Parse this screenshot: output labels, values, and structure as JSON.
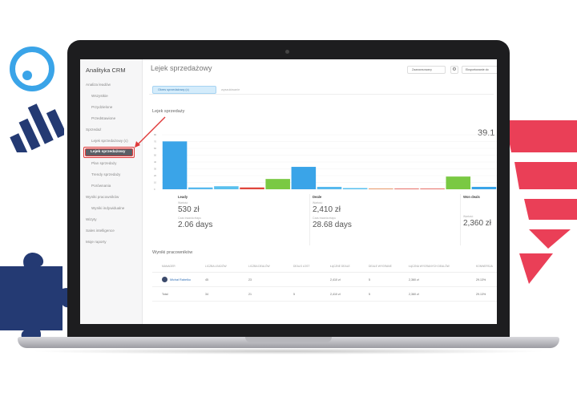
{
  "app": {
    "title": "Analityka CRM"
  },
  "sidebar": {
    "items": [
      {
        "label": "Analiza leadów"
      },
      {
        "label": "Wszystkie"
      },
      {
        "label": "Przydzielone"
      },
      {
        "label": "Przedstawione"
      },
      {
        "label": "Sprzedaż"
      },
      {
        "label": "Lejek sprzedażowy (c)"
      },
      {
        "label": "Lejek sprzedażowy"
      },
      {
        "label": "Plan sprzedaży"
      },
      {
        "label": "Trendy sprzedaży"
      },
      {
        "label": "Porównania"
      },
      {
        "label": "Wyniki pracowników"
      },
      {
        "label": "Wyniki indywidualne"
      },
      {
        "label": "Wizyty"
      },
      {
        "label": "Sales intelligence"
      },
      {
        "label": "Moje raporty"
      }
    ]
  },
  "header": {
    "page_title": "Lejek sprzedażowy",
    "select_label": "Zaawansowany",
    "settings_icon": "gear-icon",
    "button_label": "Eksportowanie do"
  },
  "filters": {
    "chip_label": "Okres sprzedażowy (c)",
    "search_placeholder": "wyszukiwanie"
  },
  "funnel_section": {
    "title": "Lejek sprzedaży",
    "top_right_partial": "39.1"
  },
  "chart_data": {
    "type": "bar",
    "categories": [
      "",
      "",
      "",
      "",
      "",
      "",
      "",
      "",
      "",
      "",
      "",
      "",
      ""
    ],
    "values": [
      79,
      3,
      5,
      3,
      17,
      37,
      4,
      2,
      1,
      1,
      1,
      21,
      4
    ],
    "colors": [
      "#3aa4e8",
      "#57b9ee",
      "#5ac0ee",
      "#e0463c",
      "#7ac943",
      "#3aa4e8",
      "#57b9ee",
      "#5ac0ee",
      "#e07a3c",
      "#e0463c",
      "#e0463c",
      "#7ac943",
      "#3aa4e8"
    ],
    "ylim": [
      0,
      90
    ],
    "yticks": [
      "80",
      "70",
      "60",
      "50",
      "40",
      "30",
      "20",
      "10",
      "0"
    ],
    "grid": true
  },
  "stages": [
    {
      "label": "Leady",
      "value_label": "Wartość",
      "value": "530 zł",
      "time_label": "Czas trwania etapu",
      "time": "2.06 days"
    },
    {
      "label": "Deale",
      "value_label": "Wartość",
      "value": "2,410 zł",
      "time_label": "Czas trwania etapu",
      "time": "28.68 days"
    },
    {
      "label": "Won deals",
      "value_label": "Wartość",
      "value": "2,360 zł"
    }
  ],
  "results": {
    "title": "Wyniki pracowników",
    "columns": [
      "MANAGER",
      "LICZBA LEADÓW",
      "LICZBA DEALÓW",
      "DEALS LOST",
      "ŁĄCZNE DEALE",
      "DEALE WYGRANE",
      "ŁĄCZNA WYGRANYCH DEALÓW",
      "KONWERSJA"
    ],
    "rows": [
      {
        "name": "Michał Rabelko",
        "cells": [
          "45",
          "23",
          "",
          "2,410 zł",
          "5",
          "2,360 zł",
          "29.13%"
        ]
      },
      {
        "name": "Total",
        "cells": [
          "34",
          "21",
          "5",
          "2,410 zł",
          "5",
          "2,360 zł",
          "29.13%"
        ]
      }
    ]
  }
}
